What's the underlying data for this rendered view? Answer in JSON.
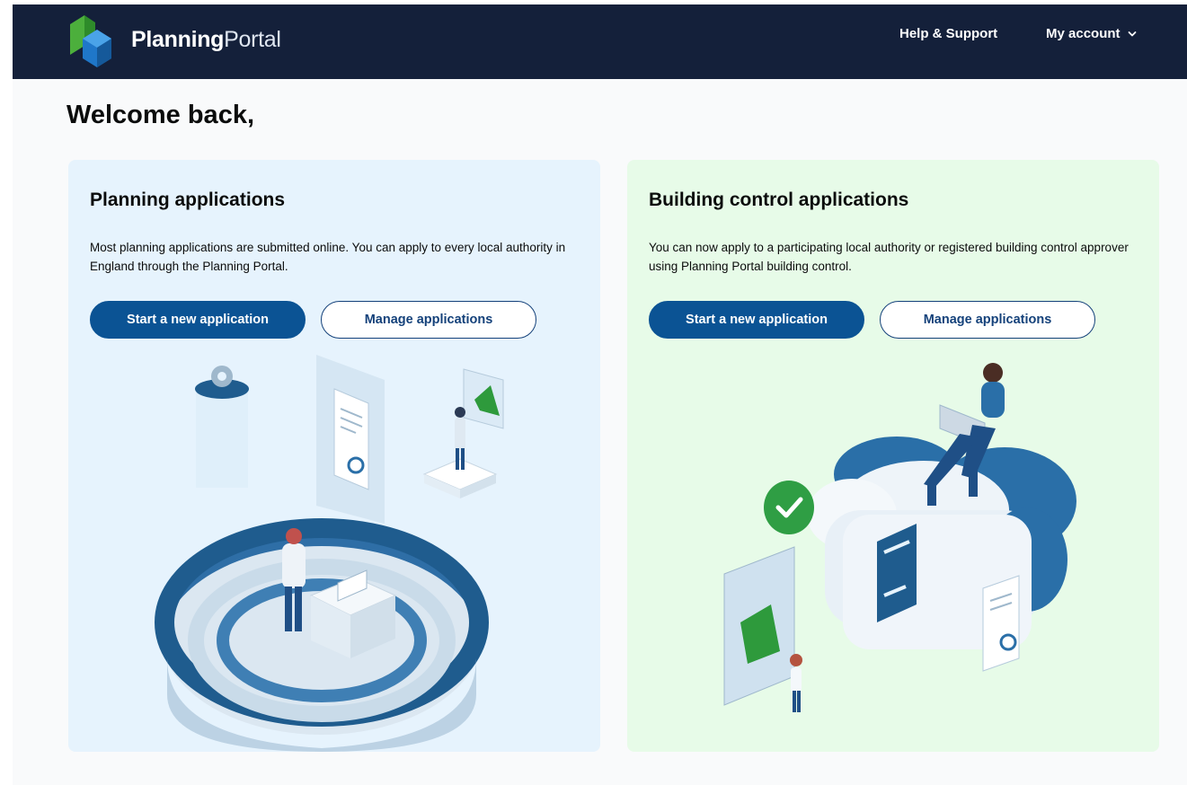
{
  "header": {
    "logo_text_bold": "Planning",
    "logo_text_light": "Portal",
    "nav": {
      "help_label": "Help & Support",
      "account_label": "My account"
    }
  },
  "welcome": {
    "title": "Welcome back,"
  },
  "cards": [
    {
      "title": "Planning applications",
      "description": "Most planning applications are submitted online. You can apply to every local authority in England through the Planning Portal.",
      "primary_button": "Start a new application",
      "secondary_button": "Manage applications"
    },
    {
      "title": "Building control applications",
      "description": "You can now apply to a participating local authority or registered building control approver using Planning Portal building control.",
      "primary_button": "Start a new application",
      "secondary_button": "Manage applications"
    }
  ],
  "colors": {
    "header_bg": "#14203a",
    "planning_card_bg": "#e6f3fd",
    "building_card_bg": "#e7fbe8",
    "primary_button": "#0b5394",
    "logo_green": "#3aaa35",
    "logo_blue": "#1b6ec2"
  }
}
